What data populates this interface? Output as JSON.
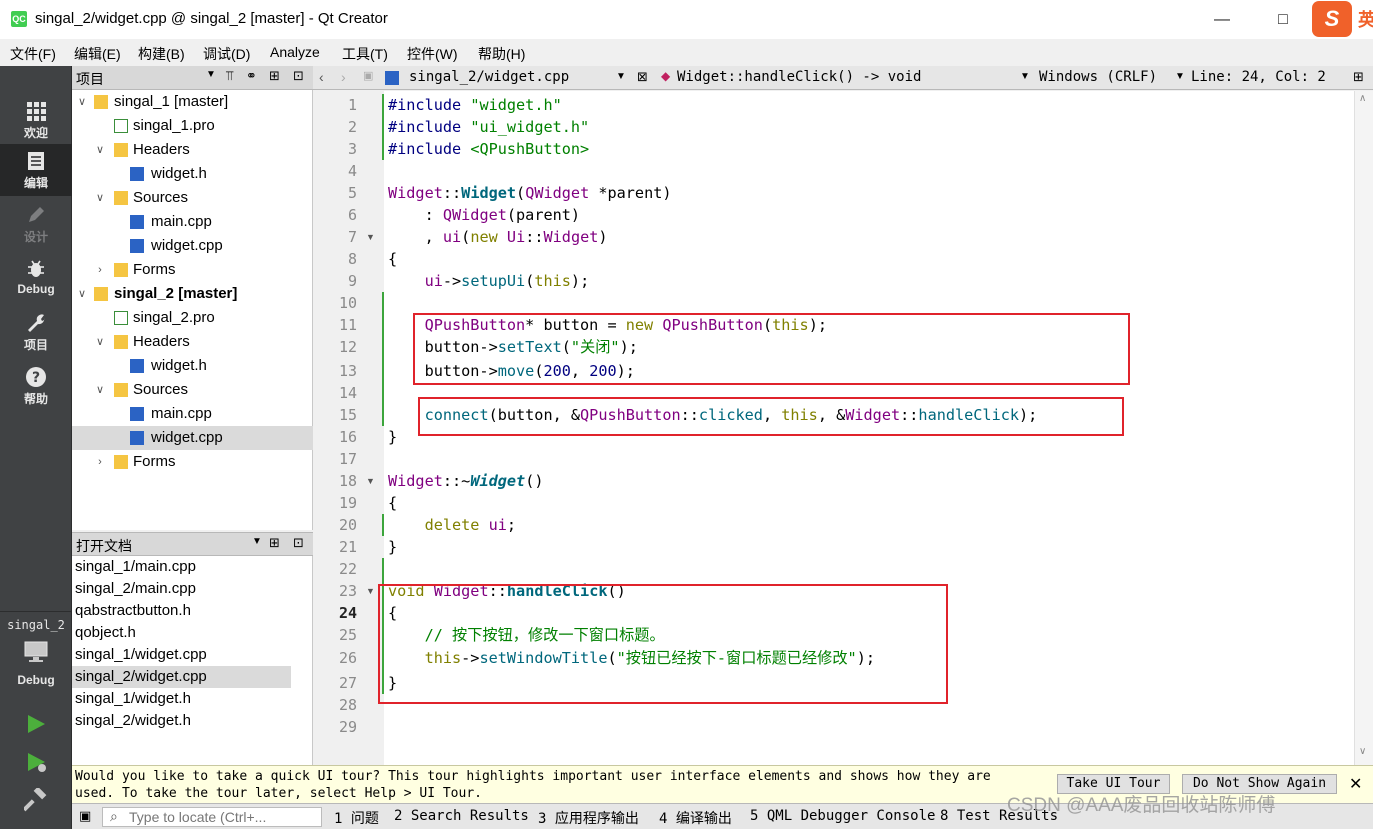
{
  "window": {
    "title": "singal_2/widget.cpp @ singal_2 [master] - Qt Creator",
    "app_icon": "QC",
    "ime_label": "英"
  },
  "menu": [
    "文件(F)",
    "编辑(E)",
    "构建(B)",
    "调试(D)",
    "Analyze",
    "工具(T)",
    "控件(W)",
    "帮助(H)"
  ],
  "modes": {
    "welcome": "欢迎",
    "edit": "编辑",
    "design": "设计",
    "debug": "Debug",
    "projects": "项目",
    "help": "帮助",
    "kit_name": "singal_2",
    "kit_mode": "Debug"
  },
  "project_panel": {
    "title": "项目",
    "tree": [
      {
        "label": "singal_1 [master]",
        "bold": false
      },
      {
        "label": "singal_1.pro"
      },
      {
        "label": "Headers"
      },
      {
        "label": "widget.h"
      },
      {
        "label": "Sources"
      },
      {
        "label": "main.cpp"
      },
      {
        "label": "widget.cpp"
      },
      {
        "label": "Forms"
      },
      {
        "label": "singal_2 [master]",
        "bold": true
      },
      {
        "label": "singal_2.pro"
      },
      {
        "label": "Headers"
      },
      {
        "label": "widget.h"
      },
      {
        "label": "Sources"
      },
      {
        "label": "main.cpp"
      },
      {
        "label": "widget.cpp"
      },
      {
        "label": "Forms"
      }
    ]
  },
  "open_documents": {
    "title": "打开文档",
    "items": [
      "singal_1/main.cpp",
      "singal_2/main.cpp",
      "qabstractbutton.h",
      "qobject.h",
      "singal_1/widget.cpp",
      "singal_2/widget.cpp",
      "singal_1/widget.h",
      "singal_2/widget.h"
    ],
    "selected": "singal_2/widget.cpp"
  },
  "editor_toolbar": {
    "file": "singal_2/widget.cpp",
    "symbol": "Widget::handleClick() -> void",
    "line_ending": "Windows (CRLF)",
    "position": "Line: 24, Col: 2"
  },
  "editor": {
    "current_line": 24,
    "lines": [
      "#include \"widget.h\"",
      "#include \"ui_widget.h\"",
      "#include <QPushButton>",
      "",
      "Widget::Widget(QWidget *parent)",
      "    : QWidget(parent)",
      "    , ui(new Ui::Widget)",
      "{",
      "    ui->setupUi(this);",
      "",
      "    QPushButton* button = new QPushButton(this);",
      "    button->setText(\"关闭\");",
      "    button->move(200, 200);",
      "",
      "    connect(button, &QPushButton::clicked, this, &Widget::handleClick);",
      "}",
      "",
      "Widget::~Widget()",
      "{",
      "    delete ui;",
      "}",
      "",
      "void Widget::handleClick()",
      "{",
      "    // 按下按钮，修改一下窗口标题。",
      "    this->setWindowTitle(\"按钮已经按下-窗口标题已经修改\");",
      "}",
      "",
      ""
    ]
  },
  "tour": {
    "text": "Would you like to take a quick UI tour? This tour highlights important user interface elements and shows how they are used. To take the tour later, select Help > UI Tour.",
    "take_button": "Take UI Tour",
    "dismiss_button": "Do Not Show Again"
  },
  "bottom_bar": {
    "locate_placeholder": "Type to locate (Ctrl+...",
    "tabs": [
      "1 问题",
      "2 Search Results",
      "3 应用程序输出",
      "4 编译输出",
      "5 QML Debugger Console",
      "8 Test Results"
    ]
  },
  "watermark": "CSDN @AAA废品回收站陈师傅",
  "colors": {
    "annotation_box": "#e0232b",
    "keyword": "#808000",
    "type": "#800080",
    "string": "#008000",
    "function": "#00677c"
  }
}
